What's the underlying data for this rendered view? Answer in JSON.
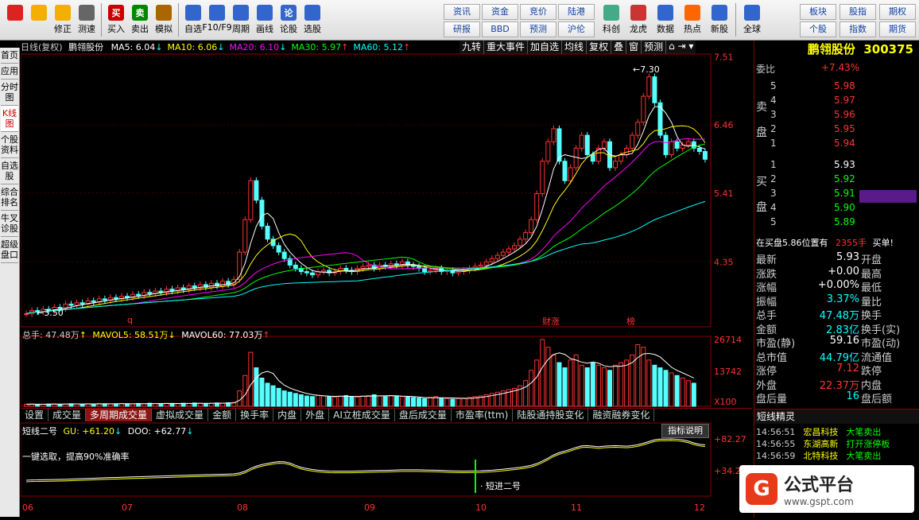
{
  "toolbar": {
    "left": [
      {
        "label": "",
        "icon": "layout-icon",
        "color": "#d22"
      },
      {
        "label": "",
        "icon": "back-arrow-icon",
        "color": "#f3b000"
      },
      {
        "label": "修正",
        "icon": "correct-icon",
        "color": "#f3b000"
      },
      {
        "label": "测速",
        "icon": "clock-icon",
        "color": "#666"
      },
      {
        "label": "买入",
        "icon": "buy-icon",
        "color": "#c00",
        "glyph": "买"
      },
      {
        "label": "卖出",
        "icon": "sell-icon",
        "color": "#080",
        "glyph": "卖"
      },
      {
        "label": "模拟",
        "icon": "hammer-icon",
        "color": "#a60"
      },
      {
        "label": "自选",
        "icon": "star-icon",
        "color": "#36c"
      },
      {
        "label": "F10/F9",
        "icon": "f10-icon",
        "color": "#36c"
      },
      {
        "label": "周期",
        "icon": "period-icon",
        "color": "#36c"
      },
      {
        "label": "画线",
        "icon": "pen-icon",
        "color": "#36c"
      },
      {
        "label": "论股",
        "icon": "discuss-icon",
        "color": "#36c",
        "glyph": "论"
      },
      {
        "label": "选股",
        "icon": "select-stock-icon",
        "color": "#36c"
      }
    ],
    "small": [
      "资讯",
      "资金",
      "竞价",
      "陆港",
      "研报",
      "BBD",
      "预测",
      "沪伦"
    ],
    "right": [
      {
        "label": "科创",
        "icon": "kechuang-icon"
      },
      {
        "label": "龙虎",
        "icon": "dragon-tiger-icon"
      },
      {
        "label": "数据",
        "icon": "pe-icon"
      },
      {
        "label": "热点",
        "icon": "hot-icon"
      },
      {
        "label": "新股",
        "icon": "new-stock-icon"
      },
      {
        "label": "全球",
        "icon": "globe-icon"
      }
    ],
    "far_right": [
      "板块",
      "股指",
      "期权",
      "个股",
      "指数",
      "期货"
    ]
  },
  "sidebar": [
    "首页",
    "应用",
    "分时图",
    "K线图",
    "个股资料",
    "自选股",
    "综合排名",
    "牛叉诊股",
    "超级盘口"
  ],
  "chart_header": {
    "label": "日线(复权)",
    "stock": "鹏翎股份",
    "ma": [
      {
        "text": "MA5: 6.04",
        "color": "#fff",
        "arrow": "↓"
      },
      {
        "text": "MA10: 6.06",
        "color": "#ff0",
        "arrow": "↓"
      },
      {
        "text": "MA20: 6.10",
        "color": "#f0f",
        "arrow": "↓"
      },
      {
        "text": "MA30: 5.97",
        "color": "#0f0",
        "arrow": "↑"
      },
      {
        "text": "MA60: 5.12",
        "color": "#0ff",
        "arrow": "↑"
      }
    ],
    "buttons": [
      "九转",
      "重大事件",
      "加自选",
      "均线",
      "复权",
      "叠",
      "窗",
      "预测"
    ]
  },
  "price_axis": [
    "7.51",
    "6.46",
    "5.41",
    "4.35"
  ],
  "price_annotations": {
    "high": "7.30",
    "low": "3.50",
    "tags": [
      "q",
      "财",
      "涨",
      "榜"
    ]
  },
  "volume": {
    "header": "总手: 47.48万",
    "mavol5": "MAVOL5: 58.51万",
    "mavol60": "MAVOL60: 77.03万",
    "axis": [
      "26714",
      "13742",
      "X100"
    ]
  },
  "tabs": [
    "设置",
    "成交量",
    "多周期成交量",
    "虚拟成交量",
    "金额",
    "换手率",
    "内盘",
    "外盘",
    "AI立桩成交量",
    "盘后成交量",
    "市盈率(ttm)",
    "陆股通持股变化",
    "融资融券变化"
  ],
  "indicator": {
    "name": "短线二号",
    "gu": "GU: +61.20",
    "doo": "DOO: +62.77",
    "desc": "一键选取，提高90%准确率",
    "explain_btn": "指标说明",
    "axis": [
      "+82.27",
      "+34.21"
    ],
    "signal": "短进二号"
  },
  "dates": [
    "06",
    "07",
    "08",
    "09",
    "10",
    "11",
    "12"
  ],
  "quote": {
    "name": "鹏翎股份",
    "code": "300375",
    "weibi_label": "委比",
    "weibi": "+7.43%",
    "sell_label": "卖盘",
    "buy_label": "买盘",
    "sells": [
      {
        "n": "5",
        "p": "5.98"
      },
      {
        "n": "4",
        "p": "5.97"
      },
      {
        "n": "3",
        "p": "5.96"
      },
      {
        "n": "2",
        "p": "5.95"
      },
      {
        "n": "1",
        "p": "5.94"
      }
    ],
    "buys": [
      {
        "n": "1",
        "p": "5.93"
      },
      {
        "n": "2",
        "p": "5.92"
      },
      {
        "n": "3",
        "p": "5.91"
      },
      {
        "n": "4",
        "p": "5.90"
      },
      {
        "n": "5",
        "p": "5.89"
      }
    ],
    "queue": "在买盘5.86位置有",
    "queue_vol": "2355手",
    "queue_end": "买单!",
    "stats": [
      {
        "l": "最新",
        "v": "5.93",
        "c": "#fff",
        "r": "开盘"
      },
      {
        "l": "涨跌",
        "v": "+0.00",
        "c": "#fff",
        "r": "最高"
      },
      {
        "l": "涨幅",
        "v": "+0.00%",
        "c": "#fff",
        "r": "最低"
      },
      {
        "l": "振幅",
        "v": "3.37%",
        "c": "#0ff",
        "r": "量比"
      },
      {
        "l": "总手",
        "v": "47.48万",
        "c": "#0ff",
        "r": "换手"
      },
      {
        "l": "金额",
        "v": "2.83亿",
        "c": "#0ff",
        "r": "换手(实)"
      },
      {
        "l": "市盈(静)",
        "v": "59.16",
        "c": "#fff",
        "r": "市盈(动)"
      },
      {
        "l": "总市值",
        "v": "44.79亿",
        "c": "#0ff",
        "r": "流通值"
      },
      {
        "l": "涨停",
        "v": "7.12",
        "c": "#f33",
        "r": "跌停"
      },
      {
        "l": "外盘",
        "v": "22.37万",
        "c": "#f33",
        "r": "内盘"
      },
      {
        "l": "盘后量",
        "v": "16",
        "c": "#0ff",
        "r": "盘后额"
      }
    ],
    "short_title": "短线精灵",
    "short": [
      {
        "t": "14:56:51",
        "n": "宏昌科技",
        "e": "大笔卖出",
        "ec": "#0f0"
      },
      {
        "t": "14:56:55",
        "n": "东湖高新",
        "e": "打开涨停板",
        "ec": "#0f0"
      },
      {
        "t": "14:56:59",
        "n": "北特科技",
        "e": "大笔卖出",
        "ec": "#0f0"
      }
    ]
  },
  "watermark": {
    "brand": "公式平台",
    "url": "www.gspt.com"
  },
  "chart_data": {
    "type": "candlestick",
    "ylim": [
      3.35,
      7.55
    ],
    "closes": [
      3.55,
      3.6,
      3.58,
      3.62,
      3.6,
      3.65,
      3.63,
      3.7,
      3.68,
      3.72,
      3.7,
      3.75,
      3.73,
      3.78,
      3.76,
      3.8,
      3.78,
      3.82,
      3.8,
      3.85,
      3.83,
      3.88,
      3.86,
      3.9,
      3.88,
      3.93,
      3.9,
      3.95,
      3.92,
      3.98,
      3.95,
      4.0,
      3.96,
      4.02,
      3.98,
      4.05,
      4.0,
      4.08,
      4.5,
      5.0,
      5.6,
      5.3,
      4.9,
      4.7,
      4.6,
      4.5,
      4.4,
      4.3,
      4.25,
      4.2,
      4.18,
      4.15,
      4.2,
      4.22,
      4.18,
      4.2,
      4.25,
      4.22,
      4.2,
      4.25,
      4.28,
      4.3,
      4.25,
      4.3,
      4.28,
      4.32,
      4.3,
      4.35,
      4.3,
      4.28,
      4.25,
      4.2,
      4.22,
      4.25,
      4.2,
      4.22,
      4.18,
      4.2,
      4.22,
      4.25,
      4.28,
      4.3,
      4.35,
      4.4,
      4.45,
      4.5,
      4.55,
      4.6,
      4.7,
      4.8,
      5.0,
      5.4,
      5.9,
      6.2,
      6.4,
      5.9,
      5.6,
      5.8,
      6.1,
      6.3,
      6.0,
      5.9,
      6.1,
      6.2,
      5.8,
      5.9,
      6.0,
      6.1,
      6.3,
      6.5,
      6.9,
      7.2,
      6.8,
      6.3,
      6.0,
      6.2,
      6.1,
      6.15,
      6.2,
      6.1,
      6.05,
      5.93
    ],
    "volumes": [
      8,
      9,
      7,
      8,
      9,
      10,
      8,
      9,
      10,
      9,
      8,
      10,
      9,
      11,
      10,
      9,
      10,
      11,
      10,
      9,
      11,
      10,
      12,
      11,
      10,
      12,
      11,
      10,
      12,
      11,
      13,
      12,
      11,
      12,
      13,
      12,
      14,
      15,
      60,
      120,
      210,
      150,
      110,
      90,
      80,
      70,
      60,
      55,
      50,
      45,
      40,
      38,
      42,
      40,
      38,
      36,
      40,
      42,
      38,
      36,
      40,
      42,
      45,
      40,
      38,
      42,
      40,
      38,
      36,
      34,
      32,
      30,
      35,
      38,
      32,
      30,
      28,
      30,
      32,
      35,
      38,
      40,
      45,
      50,
      55,
      60,
      65,
      70,
      80,
      100,
      140,
      180,
      260,
      230,
      200,
      170,
      150,
      180,
      200,
      160,
      150,
      170,
      160,
      150,
      140,
      160,
      170,
      180,
      200,
      240,
      230,
      180,
      160,
      150,
      140,
      130,
      120,
      110,
      100,
      90
    ]
  }
}
